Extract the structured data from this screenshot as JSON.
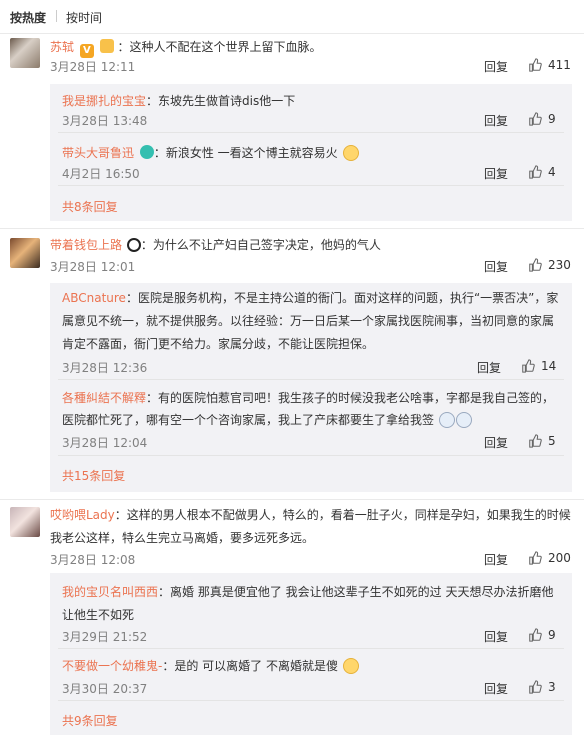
{
  "sort": {
    "hot": "按热度",
    "time": "按时间"
  },
  "reply_label": "回复",
  "comments": [
    {
      "user": "苏轼",
      "text": "：这种人不配在这个世界上留下血脉。",
      "time": "3月28日 12:11",
      "likes": "411",
      "replies": [
        {
          "user": "我是挪扎的宝宝",
          "text": "：东坡先生做首诗dis他一下",
          "time": "3月28日 13:48",
          "likes": "9"
        },
        {
          "user": "带头大哥鲁迅",
          "text": "：新浪女性 一看这个博主就容易火",
          "time": "4月2日 16:50",
          "likes": "4"
        }
      ],
      "more": "共8条回复"
    },
    {
      "user": "带着钱包上路",
      "text": "：为什么不让产妇自己签字决定，他妈的气人",
      "time": "3月28日 12:01",
      "likes": "230",
      "replies": [
        {
          "user": "ABCnature",
          "text1": "：医院是服务机构，不是主持公道的衙门。面对这样的问题，执行“一票否决”，家",
          "text2": "属意见不统一，就不提供服务。以往经验：万一日后某一个家属找医院闹事，当初同意的家属",
          "text3": "肯定不露面，衙门更不给力。家属分歧，不能让医院担保。",
          "time": "3月28日 12:36",
          "likes": "14"
        },
        {
          "user": "各種糾結不解釋",
          "text1": "：有的医院怕惹官司吧！我生孩子的时候没我老公啥事，字都是我自己签的，",
          "text2": "医院都忙死了，哪有空一个个咨询家属，我上了产床都要生了拿给我签",
          "time": "3月28日 12:04",
          "likes": "5"
        }
      ],
      "more": "共15条回复"
    },
    {
      "user": "哎哟喂Lady",
      "text1": "：这样的男人根本不配做男人，特么的，看着一肚子火，同样是孕妇，如果我生的时候",
      "text2": "我老公这样，特么生完立马离婚，要多远死多远。",
      "time": "3月28日 12:08",
      "likes": "200",
      "replies": [
        {
          "user": "我的宝贝名叫西西",
          "text1": "：离婚 那真是便宜他了 我会让他这辈子生不如死的过 天天想尽办法折磨他",
          "text2": "让他生不如死",
          "time": "3月29日 21:52",
          "likes": "9"
        },
        {
          "user": "不要做一个幼稚鬼-",
          "text": "：是的 可以离婚了 不离婚就是傻",
          "time": "3月30日 20:37",
          "likes": "3"
        }
      ],
      "more": "共9条回复"
    }
  ],
  "icons": {
    "like": "thumbs-up-icon",
    "avatar": "avatar"
  },
  "colors": {
    "username": "#eb7350",
    "meta": "#808080",
    "subbox": "#f2f2f5"
  }
}
